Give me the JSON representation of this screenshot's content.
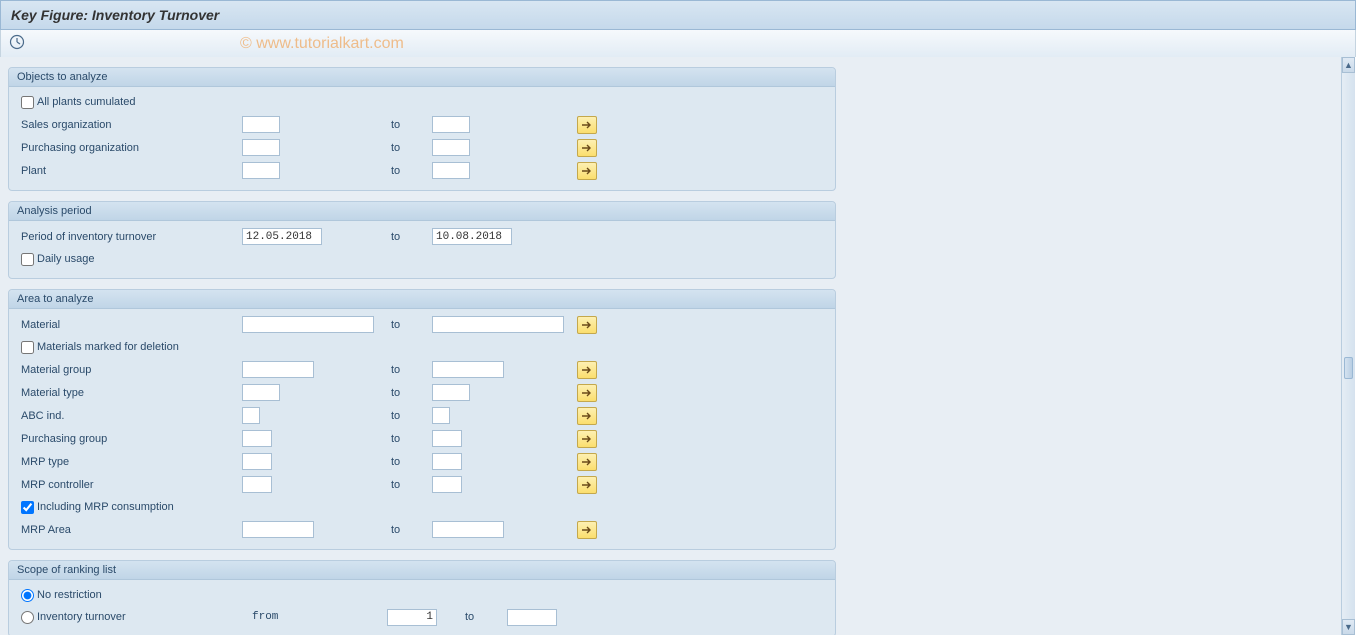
{
  "title": "Key Figure: Inventory Turnover",
  "watermark": "© www.tutorialkart.com",
  "groups": {
    "objects": {
      "title": "Objects to analyze",
      "all_plants": {
        "label": "All plants cumulated",
        "checked": false
      },
      "sales_org": {
        "label": "Sales organization",
        "from": "",
        "to": ""
      },
      "purch_org": {
        "label": "Purchasing organization",
        "from": "",
        "to": ""
      },
      "plant": {
        "label": "Plant",
        "from": "",
        "to": ""
      },
      "to_label": "to"
    },
    "period": {
      "title": "Analysis period",
      "inv_turnover": {
        "label": "Period of inventory turnover",
        "from": "12.05.2018",
        "to": "10.08.2018"
      },
      "daily_usage": {
        "label": "Daily usage",
        "checked": false
      },
      "to_label": "to"
    },
    "area": {
      "title": "Area to analyze",
      "material": {
        "label": "Material",
        "from": "",
        "to": ""
      },
      "marked_del": {
        "label": "Materials marked for deletion",
        "checked": false
      },
      "mat_group": {
        "label": "Material group",
        "from": "",
        "to": ""
      },
      "mat_type": {
        "label": "Material type",
        "from": "",
        "to": ""
      },
      "abc": {
        "label": "ABC ind.",
        "from": "",
        "to": ""
      },
      "purch_grp": {
        "label": "Purchasing group",
        "from": "",
        "to": ""
      },
      "mrp_type": {
        "label": "MRP type",
        "from": "",
        "to": ""
      },
      "mrp_ctrl": {
        "label": "MRP controller",
        "from": "",
        "to": ""
      },
      "mrp_cons": {
        "label": "Including MRP consumption",
        "checked": true
      },
      "mrp_area": {
        "label": "MRP Area",
        "from": "",
        "to": ""
      },
      "to_label": "to"
    },
    "scope": {
      "title": "Scope of ranking list",
      "no_restriction": {
        "label": "No restriction",
        "selected": true
      },
      "inv_turnover": {
        "label": "Inventory turnover",
        "selected": false,
        "from_label": "from",
        "from": "1",
        "to_label": "to",
        "to": ""
      }
    }
  }
}
